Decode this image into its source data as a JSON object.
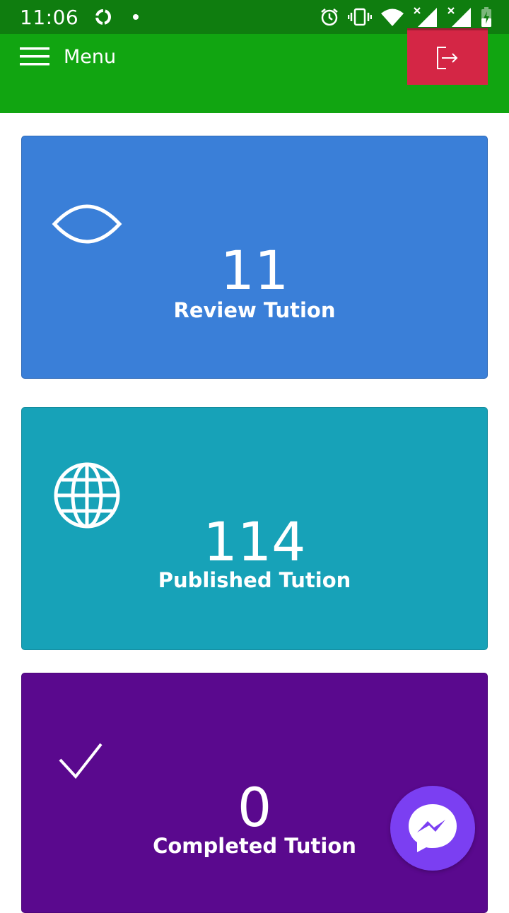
{
  "status_bar": {
    "time": "11:06",
    "left_icons": [
      "sync-icon",
      "dot-icon"
    ],
    "right_icons": [
      "alarm-icon",
      "vibrate-icon",
      "wifi-icon",
      "signal-icon",
      "signal-icon",
      "battery-charging-icon"
    ]
  },
  "app_bar": {
    "menu_label": "Menu",
    "menu_icon": "hamburger-icon",
    "logout_icon": "logout-icon",
    "colors": {
      "status": "#0f7d0f",
      "bar": "#11a511",
      "logout": "#d42645"
    }
  },
  "cards": [
    {
      "count": "11",
      "label": "Review Tution",
      "icon": "eye-icon",
      "color": "#3a7fd8"
    },
    {
      "count": "114",
      "label": "Published Tution",
      "icon": "globe-icon",
      "color": "#17a2b8"
    },
    {
      "count": "0",
      "label": "Completed Tution",
      "icon": "check-icon",
      "color": "#5a098e"
    }
  ],
  "fab": {
    "icon": "messenger-icon",
    "color": "#7b3ff2"
  }
}
